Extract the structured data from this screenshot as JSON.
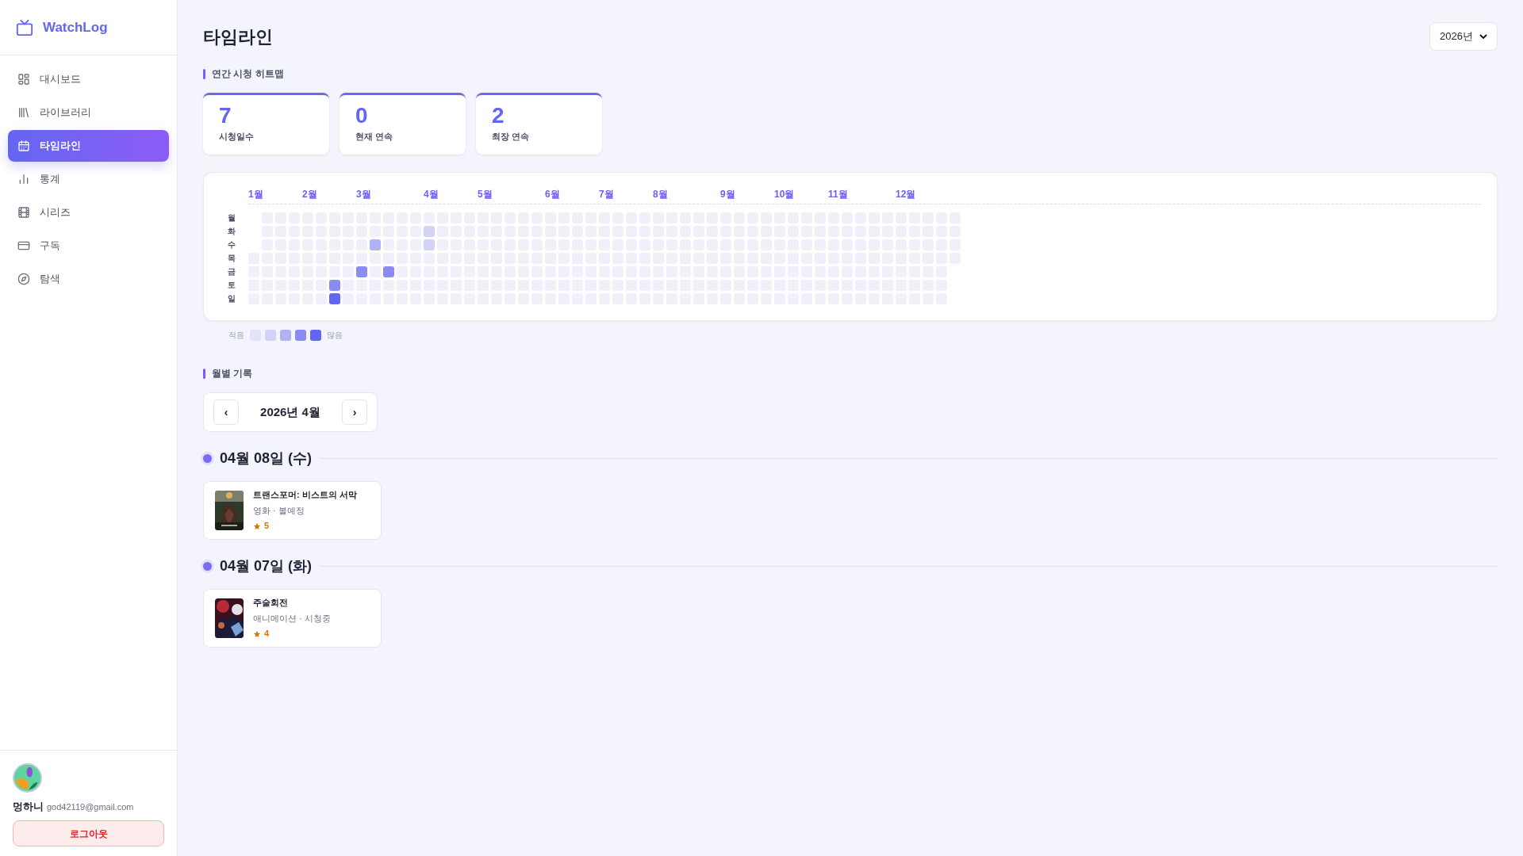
{
  "sidebar": {
    "logo": "WatchLog",
    "items": [
      {
        "label": "대시보드",
        "selected": false
      },
      {
        "label": "라이브러리",
        "selected": false
      },
      {
        "label": "타임라인",
        "selected": true
      },
      {
        "label": "통계",
        "selected": false
      },
      {
        "label": "시리즈",
        "selected": false
      },
      {
        "label": "구독",
        "selected": false
      },
      {
        "label": "탐색",
        "selected": false
      }
    ],
    "user": {
      "name": "멍하니",
      "email": "god42119@gmail.com",
      "logout": "로그아웃"
    }
  },
  "page": {
    "title": "타임라인",
    "year_select": "2026년"
  },
  "heatmap": {
    "heading": "연간 시청 히트맵",
    "stats": [
      {
        "value": "7",
        "label": "시청일수"
      },
      {
        "value": "0",
        "label": "현재 연속"
      },
      {
        "value": "2",
        "label": "최장 연속"
      }
    ],
    "months": [
      "1월",
      "2월",
      "3월",
      "4월",
      "5월",
      "6월",
      "7월",
      "8월",
      "9월",
      "10월",
      "11월",
      "12월"
    ],
    "legend": {
      "less": "적음",
      "more": "많음",
      "swatches": [
        {
          "color": "#e3e3f8"
        },
        {
          "color": "#d3d3f9"
        },
        {
          "color": "#b1b2f6"
        },
        {
          "color": "#8b8cf2"
        },
        {
          "color": "#6366f1"
        }
      ]
    },
    "rows": [
      {
        "label": "월",
        "cells": [
          {
            "kind": "empty"
          },
          {
            "color": "#f0f0fb"
          },
          {
            "color": "#f0f0fb"
          },
          {
            "color": "#f0f0fb"
          },
          {
            "color": "#f0f0fb"
          },
          {
            "color": "#f0f0fb"
          },
          {
            "color": "#f0f0fb"
          },
          {
            "color": "#f0f0fb"
          },
          {
            "color": "#f0f0fb"
          },
          {
            "color": "#f0f0fb"
          },
          {
            "color": "#f0f0fb"
          },
          {
            "color": "#f0f0fb"
          },
          {
            "color": "#f0f0fb"
          },
          {
            "color": "#f0f0fb"
          },
          {
            "color": "#f0f0fb"
          },
          {
            "color": "#f0f0fb"
          },
          {
            "color": "#f0f0fb"
          },
          {
            "color": "#f0f0fb"
          },
          {
            "color": "#f0f0fb"
          },
          {
            "color": "#f0f0fb"
          },
          {
            "color": "#f0f0fb"
          },
          {
            "color": "#f0f0fb"
          },
          {
            "color": "#f0f0fb"
          },
          {
            "color": "#f0f0fb"
          },
          {
            "color": "#f0f0fb"
          },
          {
            "color": "#f0f0fb"
          },
          {
            "color": "#f0f0fb"
          },
          {
            "color": "#f0f0fb"
          },
          {
            "color": "#f0f0fb"
          },
          {
            "color": "#f0f0fb"
          },
          {
            "color": "#f0f0fb"
          },
          {
            "color": "#f0f0fb"
          },
          {
            "color": "#f0f0fb"
          },
          {
            "color": "#f0f0fb"
          },
          {
            "color": "#f0f0fb"
          },
          {
            "color": "#f0f0fb"
          },
          {
            "color": "#f0f0fb"
          },
          {
            "color": "#f0f0fb"
          },
          {
            "color": "#f0f0fb"
          },
          {
            "color": "#f0f0fb"
          },
          {
            "color": "#f0f0fb"
          },
          {
            "color": "#f0f0fb"
          },
          {
            "color": "#f0f0fb"
          },
          {
            "color": "#f0f0fb"
          },
          {
            "color": "#f0f0fb"
          },
          {
            "color": "#f0f0fb"
          },
          {
            "color": "#f0f0fb"
          },
          {
            "color": "#f0f0fb"
          },
          {
            "color": "#f0f0fb"
          },
          {
            "color": "#f0f0fb"
          },
          {
            "color": "#f0f0fb"
          },
          {
            "color": "#f0f0fb"
          },
          {
            "color": "#f0f0fb"
          }
        ]
      },
      {
        "label": "화",
        "cells": [
          {
            "kind": "empty"
          },
          {
            "color": "#f0f0fb"
          },
          {
            "color": "#f0f0fb"
          },
          {
            "color": "#f0f0fb"
          },
          {
            "color": "#f0f0fb"
          },
          {
            "color": "#f0f0fb"
          },
          {
            "color": "#f0f0fb"
          },
          {
            "color": "#f0f0fb"
          },
          {
            "color": "#f0f0fb"
          },
          {
            "color": "#f0f0fb"
          },
          {
            "color": "#f0f0fb"
          },
          {
            "color": "#f0f0fb"
          },
          {
            "color": "#f0f0fb"
          },
          {
            "color": "#d3d3f9"
          },
          {
            "color": "#f0f0fb"
          },
          {
            "color": "#f0f0fb"
          },
          {
            "color": "#f0f0fb"
          },
          {
            "color": "#f0f0fb"
          },
          {
            "color": "#f0f0fb"
          },
          {
            "color": "#f0f0fb"
          },
          {
            "color": "#f0f0fb"
          },
          {
            "color": "#f0f0fb"
          },
          {
            "color": "#f0f0fb"
          },
          {
            "color": "#f0f0fb"
          },
          {
            "color": "#f0f0fb"
          },
          {
            "color": "#f0f0fb"
          },
          {
            "color": "#f0f0fb"
          },
          {
            "color": "#f0f0fb"
          },
          {
            "color": "#f0f0fb"
          },
          {
            "color": "#f0f0fb"
          },
          {
            "color": "#f0f0fb"
          },
          {
            "color": "#f0f0fb"
          },
          {
            "color": "#f0f0fb"
          },
          {
            "color": "#f0f0fb"
          },
          {
            "color": "#f0f0fb"
          },
          {
            "color": "#f0f0fb"
          },
          {
            "color": "#f0f0fb"
          },
          {
            "color": "#f0f0fb"
          },
          {
            "color": "#f0f0fb"
          },
          {
            "color": "#f0f0fb"
          },
          {
            "color": "#f0f0fb"
          },
          {
            "color": "#f0f0fb"
          },
          {
            "color": "#f0f0fb"
          },
          {
            "color": "#f0f0fb"
          },
          {
            "color": "#f0f0fb"
          },
          {
            "color": "#f0f0fb"
          },
          {
            "color": "#f0f0fb"
          },
          {
            "color": "#f0f0fb"
          },
          {
            "color": "#f0f0fb"
          },
          {
            "color": "#f0f0fb"
          },
          {
            "color": "#f0f0fb"
          },
          {
            "color": "#f0f0fb"
          },
          {
            "color": "#f0f0fb"
          }
        ]
      },
      {
        "label": "수",
        "cells": [
          {
            "kind": "empty"
          },
          {
            "color": "#f0f0fb"
          },
          {
            "color": "#f0f0fb"
          },
          {
            "color": "#f0f0fb"
          },
          {
            "color": "#f0f0fb"
          },
          {
            "color": "#f0f0fb"
          },
          {
            "color": "#f0f0fb"
          },
          {
            "color": "#f0f0fb"
          },
          {
            "color": "#f0f0fb"
          },
          {
            "color": "#b1b2f6"
          },
          {
            "color": "#f0f0fb"
          },
          {
            "color": "#f0f0fb"
          },
          {
            "color": "#f0f0fb"
          },
          {
            "color": "#d3d3f9"
          },
          {
            "color": "#f0f0fb"
          },
          {
            "color": "#f0f0fb"
          },
          {
            "color": "#f0f0fb"
          },
          {
            "color": "#f0f0fb"
          },
          {
            "color": "#f0f0fb"
          },
          {
            "color": "#f0f0fb"
          },
          {
            "color": "#f0f0fb"
          },
          {
            "color": "#f0f0fb"
          },
          {
            "color": "#f0f0fb"
          },
          {
            "color": "#f0f0fb"
          },
          {
            "color": "#f0f0fb"
          },
          {
            "color": "#f0f0fb"
          },
          {
            "color": "#f0f0fb"
          },
          {
            "color": "#f0f0fb"
          },
          {
            "color": "#f0f0fb"
          },
          {
            "color": "#f0f0fb"
          },
          {
            "color": "#f0f0fb"
          },
          {
            "color": "#f0f0fb"
          },
          {
            "color": "#f0f0fb"
          },
          {
            "color": "#f0f0fb"
          },
          {
            "color": "#f0f0fb"
          },
          {
            "color": "#f0f0fb"
          },
          {
            "color": "#f0f0fb"
          },
          {
            "color": "#f0f0fb"
          },
          {
            "color": "#f0f0fb"
          },
          {
            "color": "#f0f0fb"
          },
          {
            "color": "#f0f0fb"
          },
          {
            "color": "#f0f0fb"
          },
          {
            "color": "#f0f0fb"
          },
          {
            "color": "#f0f0fb"
          },
          {
            "color": "#f0f0fb"
          },
          {
            "color": "#f0f0fb"
          },
          {
            "color": "#f0f0fb"
          },
          {
            "color": "#f0f0fb"
          },
          {
            "color": "#f0f0fb"
          },
          {
            "color": "#f0f0fb"
          },
          {
            "color": "#f0f0fb"
          },
          {
            "color": "#f0f0fb"
          },
          {
            "color": "#f0f0fb"
          }
        ]
      },
      {
        "label": "목",
        "cells": [
          {
            "color": "#f0f0fb"
          },
          {
            "color": "#f0f0fb"
          },
          {
            "color": "#f0f0fb"
          },
          {
            "color": "#f0f0fb"
          },
          {
            "color": "#f0f0fb"
          },
          {
            "color": "#f0f0fb"
          },
          {
            "color": "#f0f0fb"
          },
          {
            "color": "#f0f0fb"
          },
          {
            "color": "#f0f0fb"
          },
          {
            "color": "#f0f0fb"
          },
          {
            "color": "#f0f0fb"
          },
          {
            "color": "#f0f0fb"
          },
          {
            "color": "#f0f0fb"
          },
          {
            "color": "#f0f0fb"
          },
          {
            "color": "#f0f0fb"
          },
          {
            "color": "#f0f0fb"
          },
          {
            "color": "#f0f0fb"
          },
          {
            "color": "#f0f0fb"
          },
          {
            "color": "#f0f0fb"
          },
          {
            "color": "#f0f0fb"
          },
          {
            "color": "#f0f0fb"
          },
          {
            "color": "#f0f0fb"
          },
          {
            "color": "#f0f0fb"
          },
          {
            "color": "#f0f0fb"
          },
          {
            "color": "#f0f0fb"
          },
          {
            "color": "#f0f0fb"
          },
          {
            "color": "#f0f0fb"
          },
          {
            "color": "#f0f0fb"
          },
          {
            "color": "#f0f0fb"
          },
          {
            "color": "#f0f0fb"
          },
          {
            "color": "#f0f0fb"
          },
          {
            "color": "#f0f0fb"
          },
          {
            "color": "#f0f0fb"
          },
          {
            "color": "#f0f0fb"
          },
          {
            "color": "#f0f0fb"
          },
          {
            "color": "#f0f0fb"
          },
          {
            "color": "#f0f0fb"
          },
          {
            "color": "#f0f0fb"
          },
          {
            "color": "#f0f0fb"
          },
          {
            "color": "#f0f0fb"
          },
          {
            "color": "#f0f0fb"
          },
          {
            "color": "#f0f0fb"
          },
          {
            "color": "#f0f0fb"
          },
          {
            "color": "#f0f0fb"
          },
          {
            "color": "#f0f0fb"
          },
          {
            "color": "#f0f0fb"
          },
          {
            "color": "#f0f0fb"
          },
          {
            "color": "#f0f0fb"
          },
          {
            "color": "#f0f0fb"
          },
          {
            "color": "#f0f0fb"
          },
          {
            "color": "#f0f0fb"
          },
          {
            "color": "#f0f0fb"
          },
          {
            "color": "#f0f0fb"
          }
        ]
      },
      {
        "label": "금",
        "cells": [
          {
            "color": "#f0f0fb"
          },
          {
            "color": "#f0f0fb"
          },
          {
            "color": "#f0f0fb"
          },
          {
            "color": "#f0f0fb"
          },
          {
            "color": "#f0f0fb"
          },
          {
            "color": "#f0f0fb"
          },
          {
            "color": "#f0f0fb"
          },
          {
            "color": "#f0f0fb"
          },
          {
            "color": "#8b8cf2"
          },
          {
            "color": "#f0f0fb"
          },
          {
            "color": "#8b8cf2"
          },
          {
            "color": "#f0f0fb"
          },
          {
            "color": "#f0f0fb"
          },
          {
            "color": "#f0f0fb"
          },
          {
            "color": "#f0f0fb"
          },
          {
            "color": "#f0f0fb"
          },
          {
            "color": "#f0f0fb"
          },
          {
            "color": "#f0f0fb"
          },
          {
            "color": "#f0f0fb"
          },
          {
            "color": "#f0f0fb"
          },
          {
            "color": "#f0f0fb"
          },
          {
            "color": "#f0f0fb"
          },
          {
            "color": "#f0f0fb"
          },
          {
            "color": "#f0f0fb"
          },
          {
            "color": "#f0f0fb"
          },
          {
            "color": "#f0f0fb"
          },
          {
            "color": "#f0f0fb"
          },
          {
            "color": "#f0f0fb"
          },
          {
            "color": "#f0f0fb"
          },
          {
            "color": "#f0f0fb"
          },
          {
            "color": "#f0f0fb"
          },
          {
            "color": "#f0f0fb"
          },
          {
            "color": "#f0f0fb"
          },
          {
            "color": "#f0f0fb"
          },
          {
            "color": "#f0f0fb"
          },
          {
            "color": "#f0f0fb"
          },
          {
            "color": "#f0f0fb"
          },
          {
            "color": "#f0f0fb"
          },
          {
            "color": "#f0f0fb"
          },
          {
            "color": "#f0f0fb"
          },
          {
            "color": "#f0f0fb"
          },
          {
            "color": "#f0f0fb"
          },
          {
            "color": "#f0f0fb"
          },
          {
            "color": "#f0f0fb"
          },
          {
            "color": "#f0f0fb"
          },
          {
            "color": "#f0f0fb"
          },
          {
            "color": "#f0f0fb"
          },
          {
            "color": "#f0f0fb"
          },
          {
            "color": "#f0f0fb"
          },
          {
            "color": "#f0f0fb"
          },
          {
            "color": "#f0f0fb"
          },
          {
            "color": "#f0f0fb"
          }
        ]
      },
      {
        "label": "토",
        "cells": [
          {
            "color": "#f0f0fb"
          },
          {
            "color": "#f0f0fb"
          },
          {
            "color": "#f0f0fb"
          },
          {
            "color": "#f0f0fb"
          },
          {
            "color": "#f0f0fb"
          },
          {
            "color": "#f0f0fb"
          },
          {
            "color": "#8b8cf2"
          },
          {
            "color": "#f0f0fb"
          },
          {
            "color": "#f0f0fb"
          },
          {
            "color": "#f0f0fb"
          },
          {
            "color": "#f0f0fb"
          },
          {
            "color": "#f0f0fb"
          },
          {
            "color": "#f0f0fb"
          },
          {
            "color": "#f0f0fb"
          },
          {
            "color": "#f0f0fb"
          },
          {
            "color": "#f0f0fb"
          },
          {
            "color": "#f0f0fb"
          },
          {
            "color": "#f0f0fb"
          },
          {
            "color": "#f0f0fb"
          },
          {
            "color": "#f0f0fb"
          },
          {
            "color": "#f0f0fb"
          },
          {
            "color": "#f0f0fb"
          },
          {
            "color": "#f0f0fb"
          },
          {
            "color": "#f0f0fb"
          },
          {
            "color": "#f0f0fb"
          },
          {
            "color": "#f0f0fb"
          },
          {
            "color": "#f0f0fb"
          },
          {
            "color": "#f0f0fb"
          },
          {
            "color": "#f0f0fb"
          },
          {
            "color": "#f0f0fb"
          },
          {
            "color": "#f0f0fb"
          },
          {
            "color": "#f0f0fb"
          },
          {
            "color": "#f0f0fb"
          },
          {
            "color": "#f0f0fb"
          },
          {
            "color": "#f0f0fb"
          },
          {
            "color": "#f0f0fb"
          },
          {
            "color": "#f0f0fb"
          },
          {
            "color": "#f0f0fb"
          },
          {
            "color": "#f0f0fb"
          },
          {
            "color": "#f0f0fb"
          },
          {
            "color": "#f0f0fb"
          },
          {
            "color": "#f0f0fb"
          },
          {
            "color": "#f0f0fb"
          },
          {
            "color": "#f0f0fb"
          },
          {
            "color": "#f0f0fb"
          },
          {
            "color": "#f0f0fb"
          },
          {
            "color": "#f0f0fb"
          },
          {
            "color": "#f0f0fb"
          },
          {
            "color": "#f0f0fb"
          },
          {
            "color": "#f0f0fb"
          },
          {
            "color": "#f0f0fb"
          },
          {
            "color": "#f0f0fb"
          }
        ]
      },
      {
        "label": "일",
        "cells": [
          {
            "color": "#f0f0fb"
          },
          {
            "color": "#f0f0fb"
          },
          {
            "color": "#f0f0fb"
          },
          {
            "color": "#f0f0fb"
          },
          {
            "color": "#f0f0fb"
          },
          {
            "color": "#f0f0fb"
          },
          {
            "color": "#6366f1"
          },
          {
            "color": "#f0f0fb"
          },
          {
            "color": "#f0f0fb"
          },
          {
            "color": "#f0f0fb"
          },
          {
            "color": "#f0f0fb"
          },
          {
            "color": "#f0f0fb"
          },
          {
            "color": "#f0f0fb"
          },
          {
            "color": "#f0f0fb"
          },
          {
            "color": "#f0f0fb"
          },
          {
            "color": "#f0f0fb"
          },
          {
            "color": "#f0f0fb"
          },
          {
            "color": "#f0f0fb"
          },
          {
            "color": "#f0f0fb"
          },
          {
            "color": "#f0f0fb"
          },
          {
            "color": "#f0f0fb"
          },
          {
            "color": "#f0f0fb"
          },
          {
            "color": "#f0f0fb"
          },
          {
            "color": "#f0f0fb"
          },
          {
            "color": "#f0f0fb"
          },
          {
            "color": "#f0f0fb"
          },
          {
            "color": "#f0f0fb"
          },
          {
            "color": "#f0f0fb"
          },
          {
            "color": "#f0f0fb"
          },
          {
            "color": "#f0f0fb"
          },
          {
            "color": "#f0f0fb"
          },
          {
            "color": "#f0f0fb"
          },
          {
            "color": "#f0f0fb"
          },
          {
            "color": "#f0f0fb"
          },
          {
            "color": "#f0f0fb"
          },
          {
            "color": "#f0f0fb"
          },
          {
            "color": "#f0f0fb"
          },
          {
            "color": "#f0f0fb"
          },
          {
            "color": "#f0f0fb"
          },
          {
            "color": "#f0f0fb"
          },
          {
            "color": "#f0f0fb"
          },
          {
            "color": "#f0f0fb"
          },
          {
            "color": "#f0f0fb"
          },
          {
            "color": "#f0f0fb"
          },
          {
            "color": "#f0f0fb"
          },
          {
            "color": "#f0f0fb"
          },
          {
            "color": "#f0f0fb"
          },
          {
            "color": "#f0f0fb"
          },
          {
            "color": "#f0f0fb"
          },
          {
            "color": "#f0f0fb"
          },
          {
            "color": "#f0f0fb"
          },
          {
            "color": "#f0f0fb"
          }
        ]
      }
    ]
  },
  "monthly": {
    "heading": "월별 기록",
    "prev": "‹",
    "month": "2026년 4월",
    "next": "›",
    "days": [
      {
        "date": "04월 08일 (수)",
        "entries": [
          {
            "title": "트랜스포머: 비스트의 서막",
            "meta": "영화 · 볼예정",
            "rating": "5"
          }
        ]
      },
      {
        "date": "04월 07일 (화)",
        "entries": [
          {
            "title": "주술회전",
            "meta": "애니메이션 · 시청중",
            "rating": "4"
          }
        ]
      }
    ]
  }
}
